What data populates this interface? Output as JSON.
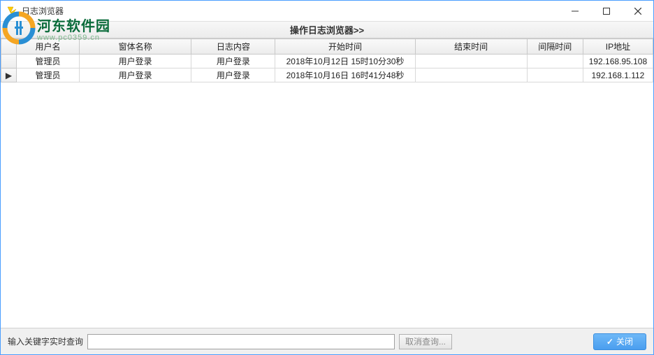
{
  "window": {
    "title": "日志浏览器"
  },
  "watermark": {
    "main": "河东软件园",
    "sub": "www.pc0359.cn"
  },
  "toolbar": {
    "title": "操作日志浏览器>>"
  },
  "table": {
    "headers": {
      "user": "用户名",
      "form": "窗体名称",
      "log": "日志内容",
      "start": "开始时间",
      "end": "结束时间",
      "interval": "间隔时间",
      "ip": "IP地址"
    },
    "rows": [
      {
        "selector": "",
        "user": "管理员",
        "form": "用户登录",
        "log": "用户登录",
        "start": "2018年10月12日 15时10分30秒",
        "end": "",
        "interval": "",
        "ip": "192.168.95.108"
      },
      {
        "selector": "▶",
        "user": "管理员",
        "form": "用户登录",
        "log": "用户登录",
        "start": "2018年10月16日 16时41分48秒",
        "end": "",
        "interval": "",
        "ip": "192.168.1.112"
      }
    ]
  },
  "footer": {
    "search_label": "输入关键字实时查询",
    "search_value": "",
    "cancel_label": "取消查询...",
    "close_label": "关闭"
  }
}
